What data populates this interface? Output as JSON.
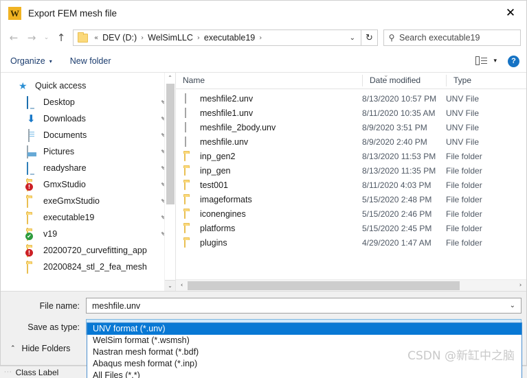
{
  "window": {
    "title": "Export FEM mesh file",
    "app_icon_letter": "W",
    "app_icon_color": "#f0b323",
    "close_label": "✕"
  },
  "nav": {
    "back_label": "←",
    "forward_label": "→",
    "recent_label": "⌄",
    "up_label": "↑",
    "breadcrumb_prefix": "«",
    "breadcrumb": [
      "DEV (D:)",
      "WelSimLLC",
      "executable19"
    ],
    "breadcrumb_separator": "›",
    "dropdown_chevron": "⌄",
    "refresh_label": "↻"
  },
  "search": {
    "placeholder": "Search executable19",
    "icon": "search-icon",
    "icon_glyph": "⚲"
  },
  "toolbar": {
    "organize_label": "Organize",
    "organize_caret": "▾",
    "new_folder_label": "New folder",
    "view_caret": "▾",
    "help_label": "?"
  },
  "sidebar": {
    "scroll_up": "⌃",
    "scroll_down": "⌄",
    "pin_glyph": "📌",
    "items": [
      {
        "label": "Quick access",
        "icon": "star-icon",
        "level": "root",
        "pinned": false,
        "badge": "none"
      },
      {
        "label": "Desktop",
        "icon": "monitor-icon",
        "level": "child",
        "pinned": true,
        "badge": "none"
      },
      {
        "label": "Downloads",
        "icon": "download-arrow-icon",
        "level": "child",
        "pinned": true,
        "badge": "none"
      },
      {
        "label": "Documents",
        "icon": "document-icon",
        "level": "child",
        "pinned": true,
        "badge": "none"
      },
      {
        "label": "Pictures",
        "icon": "picture-icon",
        "level": "child",
        "pinned": true,
        "badge": "none"
      },
      {
        "label": "readyshare",
        "icon": "network-monitor-icon",
        "level": "child",
        "pinned": true,
        "badge": "none"
      },
      {
        "label": "GmxStudio",
        "icon": "folder-icon",
        "level": "child",
        "pinned": true,
        "badge": "error"
      },
      {
        "label": "exeGmxStudio",
        "icon": "folder-icon",
        "level": "child",
        "pinned": true,
        "badge": "none"
      },
      {
        "label": "executable19",
        "icon": "folder-icon",
        "level": "child",
        "pinned": true,
        "badge": "none"
      },
      {
        "label": "v19",
        "icon": "folder-icon",
        "level": "child",
        "pinned": true,
        "badge": "ok"
      },
      {
        "label": "20200720_curvefitting_app",
        "icon": "folder-icon",
        "level": "child",
        "pinned": false,
        "badge": "error"
      },
      {
        "label": "20200824_stl_2_fea_mesh",
        "icon": "folder-icon",
        "level": "child",
        "pinned": false,
        "badge": "none"
      }
    ]
  },
  "filelist": {
    "columns": [
      "Name",
      "Date modified",
      "Type"
    ],
    "sort_marker": "⌄",
    "rows": [
      {
        "name": "meshfile2.unv",
        "date": "8/13/2020 10:57 PM",
        "type": "UNV File",
        "icon": "file-icon"
      },
      {
        "name": "meshfile1.unv",
        "date": "8/11/2020 10:35 AM",
        "type": "UNV File",
        "icon": "file-icon"
      },
      {
        "name": "meshfile_2body.unv",
        "date": "8/9/2020 3:51 PM",
        "type": "UNV File",
        "icon": "file-icon"
      },
      {
        "name": "meshfile.unv",
        "date": "8/9/2020 2:40 PM",
        "type": "UNV File",
        "icon": "file-icon"
      },
      {
        "name": "inp_gen2",
        "date": "8/13/2020 11:53 PM",
        "type": "File folder",
        "icon": "folder-icon"
      },
      {
        "name": "inp_gen",
        "date": "8/13/2020 11:35 PM",
        "type": "File folder",
        "icon": "folder-icon"
      },
      {
        "name": "test001",
        "date": "8/11/2020 4:03 PM",
        "type": "File folder",
        "icon": "folder-icon"
      },
      {
        "name": "imageformats",
        "date": "5/15/2020 2:48 PM",
        "type": "File folder",
        "icon": "folder-icon"
      },
      {
        "name": "iconengines",
        "date": "5/15/2020 2:46 PM",
        "type": "File folder",
        "icon": "folder-icon"
      },
      {
        "name": "platforms",
        "date": "5/15/2020 2:45 PM",
        "type": "File folder",
        "icon": "folder-icon"
      },
      {
        "name": "plugins",
        "date": "4/29/2020 1:47 AM",
        "type": "File folder",
        "icon": "folder-icon"
      }
    ],
    "hscroll_left": "‹",
    "hscroll_right": "›"
  },
  "form": {
    "file_name_label": "File name:",
    "file_name_value": "meshfile.unv",
    "save_as_type_label": "Save as type:",
    "save_as_type_value": "UNV format (*.unv)",
    "combo_chevron": "⌄",
    "hide_folders_label": "Hide Folders",
    "hide_folders_caret": "⌃"
  },
  "dropdown": {
    "selected_index": 0,
    "options": [
      "UNV format (*.unv)",
      "WelSim format (*.wsmsh)",
      "Nastran mesh format (*.bdf)",
      "Abaqus mesh format (*.inp)",
      "All Files (*.*)"
    ]
  },
  "background": {
    "class_label": "Class Label",
    "tree_dots": "···"
  },
  "watermark": {
    "text": "CSDN @新缸中之脑"
  }
}
